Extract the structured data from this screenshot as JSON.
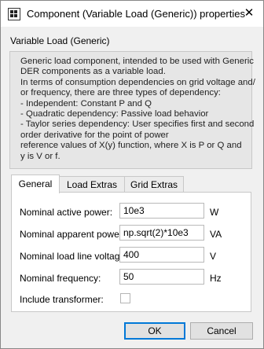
{
  "window": {
    "title": "Component (Variable Load (Generic)) properties",
    "close_glyph": "✕"
  },
  "section_label": "Variable Load (Generic)",
  "description_lines": [
    "Generic load component, intended to be used with Generic",
    "DER components as a variable load.",
    "In terms of consumption dependencies on grid voltage and/",
    "or frequency, there are three types of dependency:",
    "- Independent: Constant P and Q",
    "- Quadratic dependency: Passive load behavior",
    "- Taylor series dependency: User specifies first and second",
    "order derivative for the point of power",
    "reference values of X(y) function, where X is P or Q and",
    "y is V or f."
  ],
  "tabs": [
    {
      "label": "General",
      "active": true
    },
    {
      "label": "Load Extras",
      "active": false
    },
    {
      "label": "Grid Extras",
      "active": false
    }
  ],
  "general": {
    "fields": [
      {
        "label": "Nominal active power:",
        "value": "10e3",
        "unit": "W"
      },
      {
        "label": "Nominal apparent power:",
        "value": "np.sqrt(2)*10e3",
        "unit": "VA"
      },
      {
        "label": "Nominal load line voltage:",
        "value": "400",
        "unit": "V"
      },
      {
        "label": "Nominal frequency:",
        "value": "50",
        "unit": "Hz"
      }
    ],
    "include_transformer": {
      "label": "Include transformer:",
      "checked": false
    }
  },
  "buttons": {
    "ok": "OK",
    "cancel": "Cancel"
  }
}
